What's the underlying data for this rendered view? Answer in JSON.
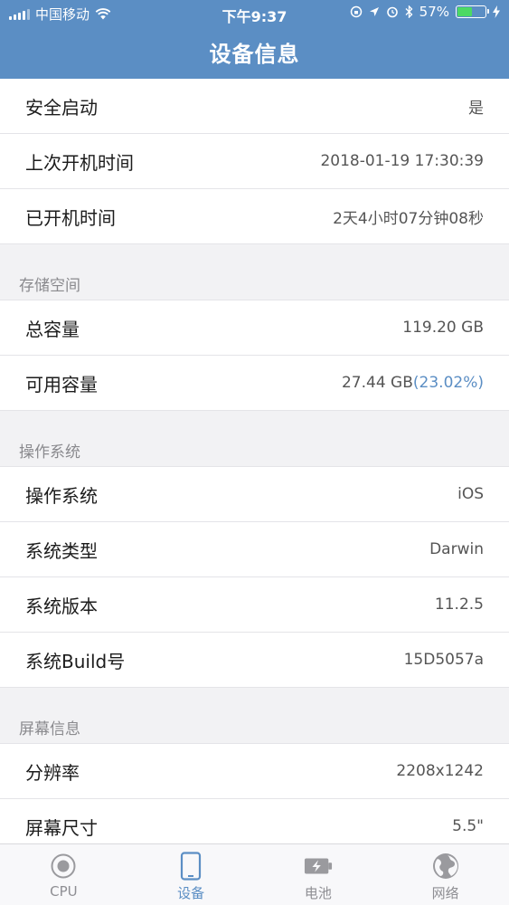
{
  "status_bar": {
    "carrier": "中国移动",
    "time": "下午9:37",
    "battery_percent": "57%",
    "battery_level": 0.57
  },
  "nav": {
    "title": "设备信息"
  },
  "top_rows": [
    {
      "label": "安全启动",
      "value": "是"
    },
    {
      "label": "上次开机时间",
      "value": "2018-01-19 17:30:39"
    },
    {
      "label": "已开机时间",
      "value": "2天4小时07分钟08秒"
    }
  ],
  "storage": {
    "header": "存储空间",
    "total_label": "总容量",
    "total_value": "119.20 GB",
    "available_label": "可用容量",
    "available_value": "27.44 GB",
    "available_percent": "(23.02%)"
  },
  "os": {
    "header": "操作系统",
    "rows": [
      {
        "label": "操作系统",
        "value": "iOS"
      },
      {
        "label": "系统类型",
        "value": "Darwin"
      },
      {
        "label": "系统版本",
        "value": "11.2.5"
      },
      {
        "label": "系统Build号",
        "value": "15D5057a"
      }
    ]
  },
  "screen": {
    "header": "屏幕信息",
    "rows": [
      {
        "label": "分辨率",
        "value": "2208x1242"
      },
      {
        "label": "屏幕尺寸",
        "value": "5.5\""
      }
    ]
  },
  "tabs": [
    {
      "label": "CPU",
      "icon": "cpu-icon",
      "active": false
    },
    {
      "label": "设备",
      "icon": "device-icon",
      "active": true
    },
    {
      "label": "电池",
      "icon": "battery-charging-icon",
      "active": false
    },
    {
      "label": "网络",
      "icon": "globe-icon",
      "active": false
    }
  ],
  "colors": {
    "header": "#5b8ec4",
    "accent": "#5b8ec4",
    "battery_fill": "#4cd964",
    "inactive_tab": "#8e8e93"
  }
}
